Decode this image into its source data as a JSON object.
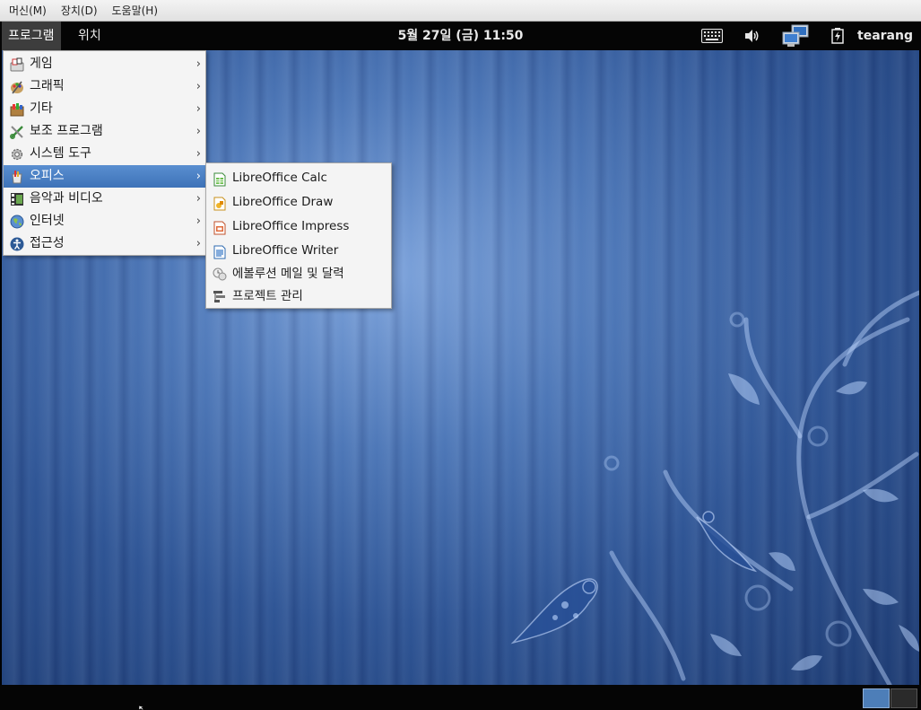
{
  "host_menubar": {
    "items": [
      "머신(M)",
      "장치(D)",
      "도움말(H)"
    ]
  },
  "top_panel": {
    "applications_label": "프로그램",
    "places_label": "위치",
    "clock": "5월 27일 (금) 11:50",
    "user": "tearang",
    "tray_icons": [
      "keyboard-icon",
      "volume-icon",
      "network-icon",
      "battery-icon"
    ]
  },
  "applications_menu": {
    "items": [
      {
        "label": "게임",
        "icon": "games-icon"
      },
      {
        "label": "그래픽",
        "icon": "graphics-icon"
      },
      {
        "label": "기타",
        "icon": "other-icon"
      },
      {
        "label": "보조 프로그램",
        "icon": "accessories-icon"
      },
      {
        "label": "시스템 도구",
        "icon": "system-tools-icon"
      },
      {
        "label": "오피스",
        "icon": "office-icon",
        "active": true
      },
      {
        "label": "음악과 비디오",
        "icon": "multimedia-icon"
      },
      {
        "label": "인터넷",
        "icon": "internet-icon"
      },
      {
        "label": "접근성",
        "icon": "accessibility-icon"
      }
    ],
    "arrow": "›"
  },
  "office_submenu": {
    "items": [
      {
        "label": "LibreOffice Calc",
        "icon": "libreoffice-calc-icon"
      },
      {
        "label": "LibreOffice Draw",
        "icon": "libreoffice-draw-icon"
      },
      {
        "label": "LibreOffice Impress",
        "icon": "libreoffice-impress-icon"
      },
      {
        "label": "LibreOffice Writer",
        "icon": "libreoffice-writer-icon"
      },
      {
        "label": "에볼루션 메일 및 달력",
        "icon": "evolution-icon"
      },
      {
        "label": "프로젝트 관리",
        "icon": "project-management-icon"
      }
    ]
  },
  "colors": {
    "menu_highlight": "#4a80c4",
    "panel_bg": "#050505",
    "wallpaper_blue": "#3a63a6"
  }
}
